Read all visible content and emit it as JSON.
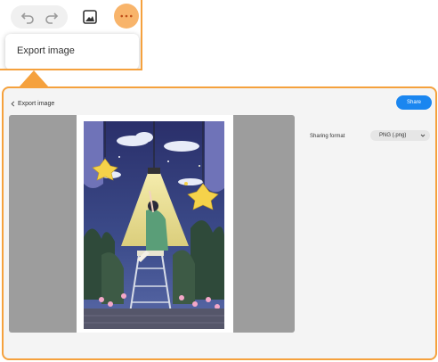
{
  "toolbar": {
    "undo_icon": "undo-icon",
    "redo_icon": "redo-icon",
    "image_icon": "image-icon",
    "more_icon": "more-icon"
  },
  "menu": {
    "export_label": "Export image"
  },
  "panel": {
    "back_label": "Export image",
    "share_label": "Share",
    "format_label": "Sharing format",
    "format_value": "PNG (.png)"
  },
  "colors": {
    "accent": "#f5a13d",
    "share_blue": "#1a86f0",
    "more_button": "#f8b46b"
  }
}
